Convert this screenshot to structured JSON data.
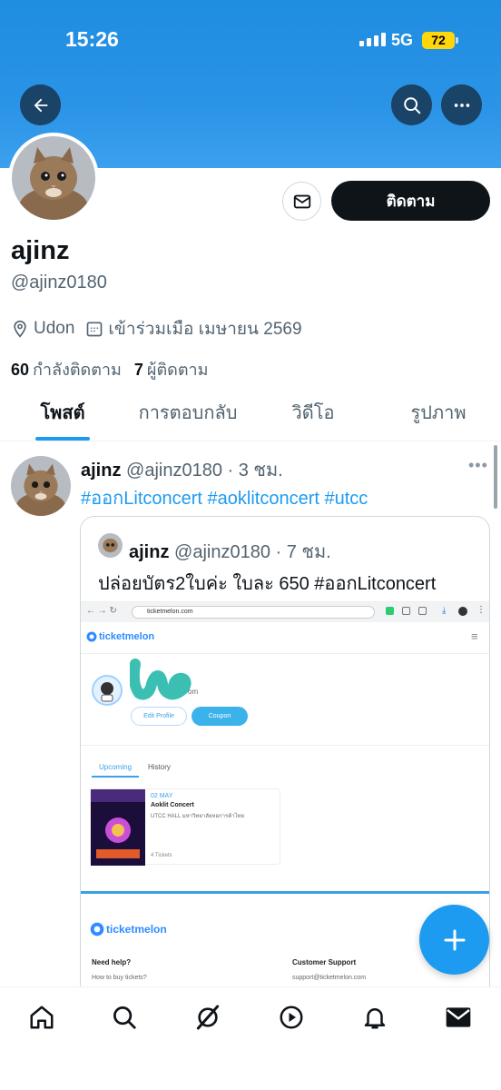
{
  "status_bar": {
    "time": "15:26",
    "network": "5G",
    "battery": "72"
  },
  "profile": {
    "name": "ajinz",
    "handle": "@ajinz0180",
    "location": "Udon",
    "joined": "เข้าร่วมเมือ เมษายน 2569",
    "following_count": "60",
    "following_label": "กำลังติดตาม",
    "followers_count": "7",
    "followers_label": "ผู้ติดตาม",
    "follow_button": "ติดตาม"
  },
  "tabs": [
    {
      "label": "โพสต์",
      "active": true
    },
    {
      "label": "การตอบกลับ",
      "active": false
    },
    {
      "label": "วิดีโอ",
      "active": false
    },
    {
      "label": "รูปภาพ",
      "active": false
    }
  ],
  "post": {
    "author": "ajinz",
    "handle": "@ajinz0180",
    "time": "· 3 ชม.",
    "text": "#ออกLitconcert #aoklitconcert #utcc",
    "quote": {
      "author": "ajinz",
      "handle": "@ajinz0180",
      "time": "· 7 ชม.",
      "text": "ปล่อยบัตร2ใบค่ะ ใบละ 650 #ออกLitconcert",
      "screenshot": {
        "url": "ticketmelon.com",
        "logo": "ticketmelon",
        "email_suffix": "om",
        "edit_profile": "Edit Profile",
        "coupon": "Coupon",
        "tab_upcoming": "Upcoming",
        "tab_history": "History",
        "event_date": "02 MAY",
        "event_name": "Aoklit Concert",
        "event_venue": "UTCC HALL มหาวิทยาลัยหอการค้าไทย",
        "event_tickets": "4 Tickets",
        "footer_logo": "ticketmelon",
        "need_help": "Need help?",
        "how_to": "How to buy tickets?",
        "customer_support": "Customer Support",
        "support_email": "support@ticketmelon.com"
      }
    }
  },
  "colors": {
    "accent": "#1d9bf0",
    "banner": "#2a93e6",
    "text": "#0f1419",
    "muted": "#536471"
  },
  "nav": [
    "home-icon",
    "search-icon",
    "grok-icon",
    "video-icon",
    "bell-icon",
    "mail-icon"
  ]
}
